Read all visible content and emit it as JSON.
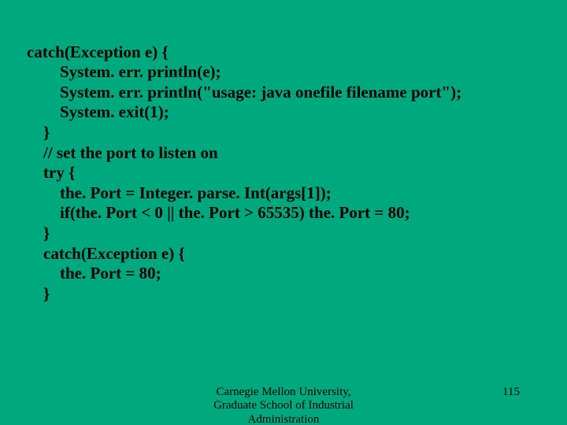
{
  "code": {
    "l1": "catch(Exception e) {",
    "l2": "        System. err. println(e);",
    "l3": "        System. err. println(\"usage: java onefile filename port\");",
    "l4": "        System. exit(1);",
    "l5": "    }",
    "l6": "    // set the port to listen on",
    "l7": "    try {",
    "l8": "        the. Port = Integer. parse. Int(args[1]);",
    "l9": "        if(the. Port < 0 || the. Port > 65535) the. Port = 80;",
    "l10": "    }",
    "l11": "    catch(Exception e) {",
    "l12": "        the. Port = 80;",
    "l13": "    }"
  },
  "footer": {
    "line1": "Carnegie Mellon University,",
    "line2": "Graduate School of Industrial",
    "line3": "Administration",
    "page": "115"
  }
}
